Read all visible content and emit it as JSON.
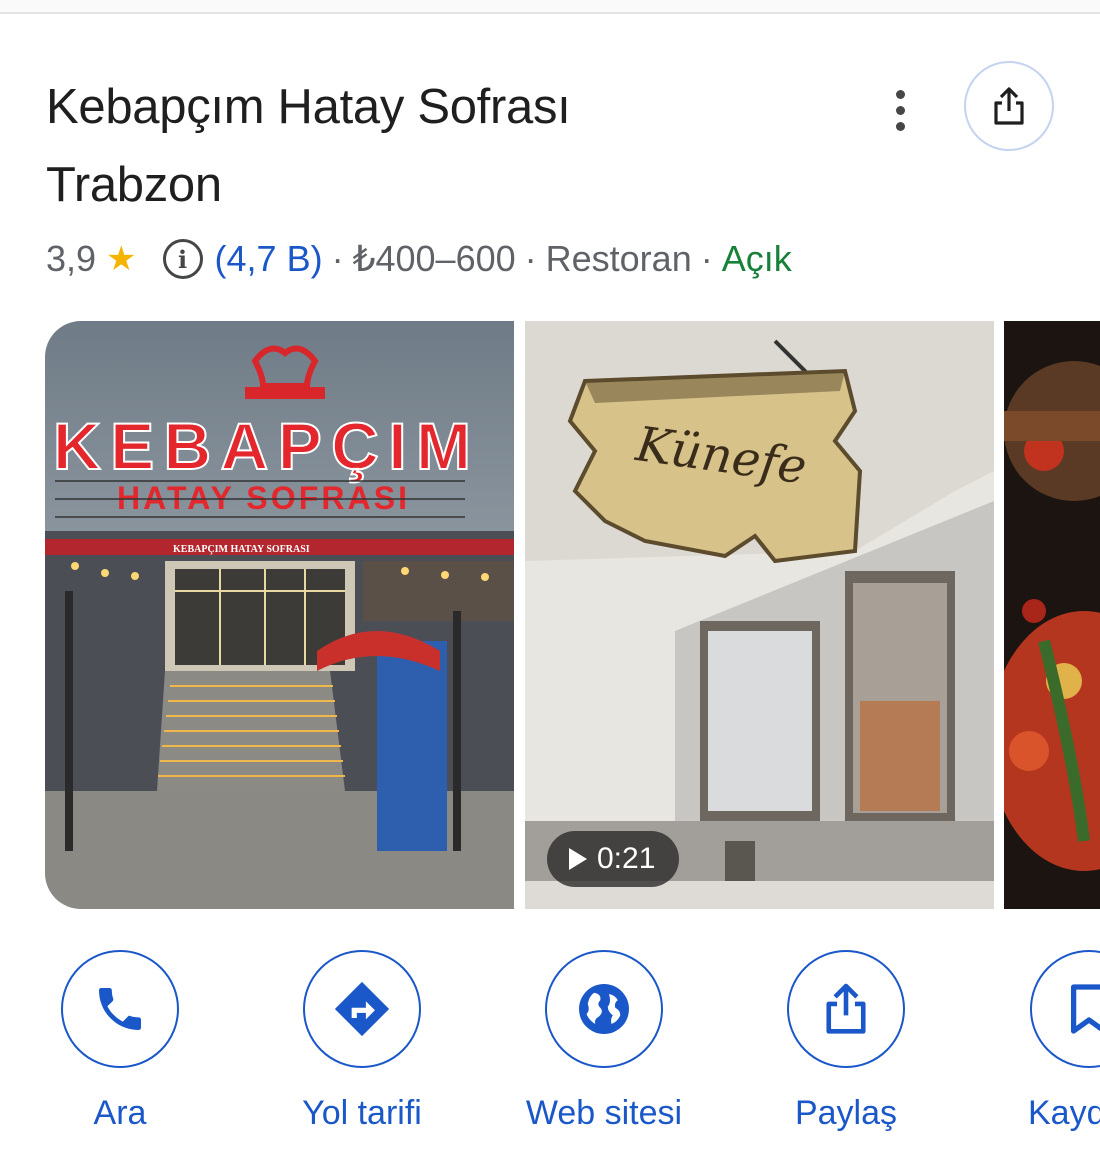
{
  "place": {
    "title_line1": "Kebapçım Hatay Sofrası",
    "title_line2": "Trabzon",
    "rating": "3,9",
    "star": "★",
    "info_icon": "i",
    "review_count": "(4,7 B)",
    "price": "₺400–600",
    "category": "Restoran",
    "status": "Açık",
    "separator": "·"
  },
  "photos": [
    {
      "icon": "storefront-photo",
      "sign_text": "KEBAPÇIM",
      "sign_subtext": "HATAY SOFRASI",
      "awning_text": "KEBAPÇIM    HATAY    SOFRASI"
    },
    {
      "icon": "kunefe-sign-video",
      "sign_text": "Künefe",
      "video_duration": "0:21"
    },
    {
      "icon": "food-photo"
    }
  ],
  "actions": [
    {
      "label": "Ara",
      "icon": "phone-icon"
    },
    {
      "label": "Yol tarifi",
      "icon": "directions-icon"
    },
    {
      "label": "Web sitesi",
      "icon": "globe-icon"
    },
    {
      "label": "Paylaş",
      "icon": "share-icon"
    },
    {
      "label": "Kaydet",
      "icon": "bookmark-icon"
    }
  ],
  "colors": {
    "accent": "#1a57c9",
    "open_status": "#188038",
    "star": "#f4b400",
    "text_secondary": "#5f6368"
  }
}
